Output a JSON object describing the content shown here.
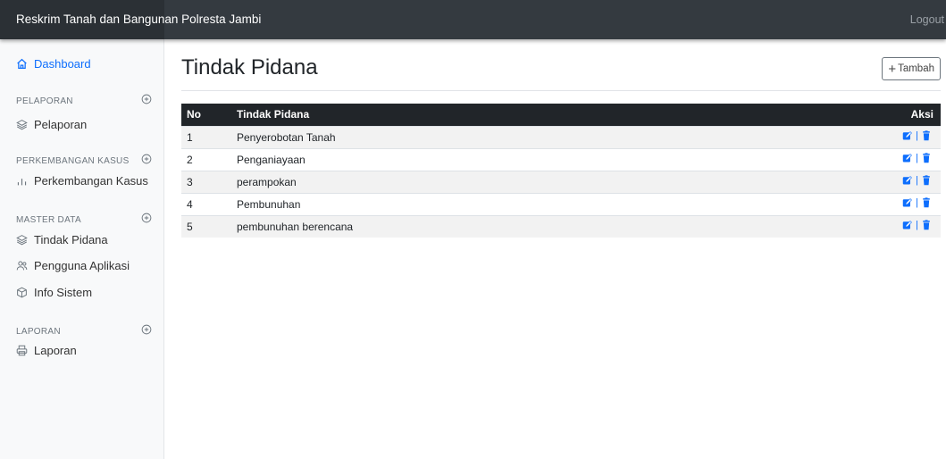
{
  "app": {
    "brand": "Reskrim Tanah dan Bangunan Polresta Jambi",
    "logout_label": "Logout"
  },
  "sidebar": {
    "dashboard_label": "Dashboard",
    "sections": [
      {
        "title": "PELAPORAN",
        "items": [
          {
            "label": "Pelaporan",
            "icon": "layers-icon"
          }
        ]
      },
      {
        "title": "PERKEMBANGAN KASUS",
        "items": [
          {
            "label": "Perkembangan Kasus",
            "icon": "bar-chart-icon"
          }
        ]
      },
      {
        "title": "MASTER DATA",
        "items": [
          {
            "label": "Tindak Pidana",
            "icon": "layers-icon"
          },
          {
            "label": "Pengguna Aplikasi",
            "icon": "users-icon"
          },
          {
            "label": "Info Sistem",
            "icon": "box-icon"
          }
        ]
      },
      {
        "title": "LAPORAN",
        "items": [
          {
            "label": "Laporan",
            "icon": "printer-icon"
          }
        ]
      }
    ]
  },
  "main": {
    "title": "Tindak Pidana",
    "add_button": "Tambah",
    "table": {
      "headers": [
        "No",
        "Tindak Pidana",
        "Aksi"
      ],
      "rows": [
        {
          "no": "1",
          "name": "Penyerobotan Tanah"
        },
        {
          "no": "2",
          "name": "Penganiayaan"
        },
        {
          "no": "3",
          "name": "perampokan"
        },
        {
          "no": "4",
          "name": "Pembunuhan"
        },
        {
          "no": "5",
          "name": "pembunuhan berencana"
        }
      ],
      "separator": "|"
    }
  },
  "colors": {
    "accent": "#0d6efd",
    "topbar": "#343a40",
    "table_header": "#212529"
  }
}
